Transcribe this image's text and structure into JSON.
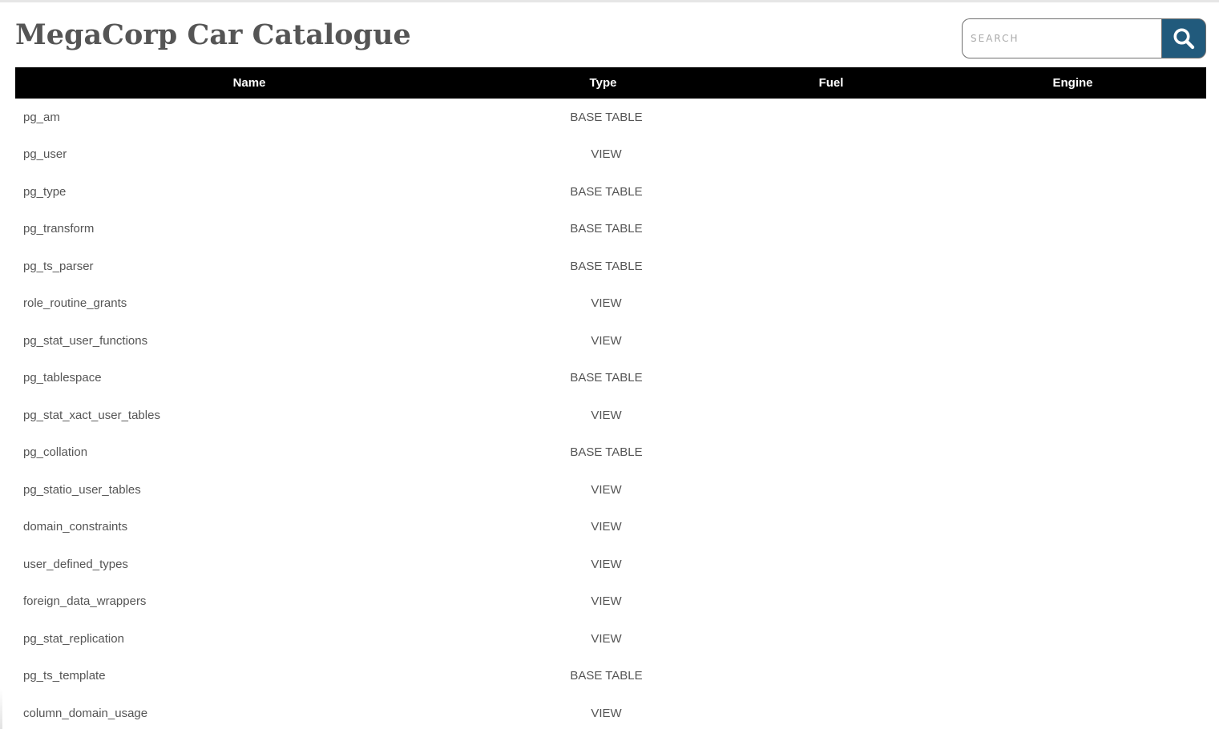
{
  "header": {
    "title": "MegaCorp Car Catalogue"
  },
  "search": {
    "placeholder": "SEARCH",
    "value": "",
    "button_icon": "search-icon",
    "button_color": "#215a7c"
  },
  "table": {
    "columns": [
      "Name",
      "Type",
      "Fuel",
      "Engine"
    ],
    "rows": [
      {
        "name": "pg_am",
        "type": "BASE TABLE",
        "fuel": "",
        "engine": ""
      },
      {
        "name": "pg_user",
        "type": "VIEW",
        "fuel": "",
        "engine": ""
      },
      {
        "name": "pg_type",
        "type": "BASE TABLE",
        "fuel": "",
        "engine": ""
      },
      {
        "name": "pg_transform",
        "type": "BASE TABLE",
        "fuel": "",
        "engine": ""
      },
      {
        "name": "pg_ts_parser",
        "type": "BASE TABLE",
        "fuel": "",
        "engine": ""
      },
      {
        "name": "role_routine_grants",
        "type": "VIEW",
        "fuel": "",
        "engine": ""
      },
      {
        "name": "pg_stat_user_functions",
        "type": "VIEW",
        "fuel": "",
        "engine": ""
      },
      {
        "name": "pg_tablespace",
        "type": "BASE TABLE",
        "fuel": "",
        "engine": ""
      },
      {
        "name": "pg_stat_xact_user_tables",
        "type": "VIEW",
        "fuel": "",
        "engine": ""
      },
      {
        "name": "pg_collation",
        "type": "BASE TABLE",
        "fuel": "",
        "engine": ""
      },
      {
        "name": "pg_statio_user_tables",
        "type": "VIEW",
        "fuel": "",
        "engine": ""
      },
      {
        "name": "domain_constraints",
        "type": "VIEW",
        "fuel": "",
        "engine": ""
      },
      {
        "name": "user_defined_types",
        "type": "VIEW",
        "fuel": "",
        "engine": ""
      },
      {
        "name": "foreign_data_wrappers",
        "type": "VIEW",
        "fuel": "",
        "engine": ""
      },
      {
        "name": "pg_stat_replication",
        "type": "VIEW",
        "fuel": "",
        "engine": ""
      },
      {
        "name": "pg_ts_template",
        "type": "BASE TABLE",
        "fuel": "",
        "engine": ""
      },
      {
        "name": "column_domain_usage",
        "type": "VIEW",
        "fuel": "",
        "engine": ""
      }
    ]
  }
}
